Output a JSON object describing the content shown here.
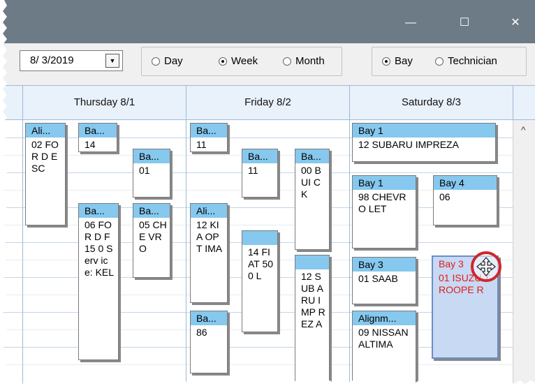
{
  "window": {
    "controls": {
      "minimize": "—",
      "maximize": "☐",
      "close": "✕"
    }
  },
  "toolbar": {
    "date_value": "8/  3/2019",
    "dropdown_icon": "chevron-down-icon",
    "view_options": [
      {
        "label": "Day",
        "selected": false
      },
      {
        "label": "Week",
        "selected": true
      },
      {
        "label": "Month",
        "selected": false
      }
    ],
    "group_options": [
      {
        "label": "Bay",
        "selected": true
      },
      {
        "label": "Technician",
        "selected": false
      }
    ]
  },
  "columns": [
    {
      "label": "Thursday 8/1"
    },
    {
      "label": "Friday 8/2"
    },
    {
      "label": "Saturday 8/3"
    }
  ],
  "appointments": [
    {
      "header": "Ali...",
      "body": "02 FOR D ESC"
    },
    {
      "header": "Ba...",
      "body": "14"
    },
    {
      "header": "Ba...",
      "body": "01"
    },
    {
      "header": "Ba...",
      "body": "06 FOR D F15 0 Serv ice: KEL"
    },
    {
      "header": "Ba...",
      "body": "05 CHE VRO"
    },
    {
      "header": "Ba...",
      "body": "11"
    },
    {
      "header": "Ba...",
      "body": "11"
    },
    {
      "header": "Ba...",
      "body": "00 BUI CK"
    },
    {
      "header": "Ali...",
      "body": "12 KIA OPT IMA"
    },
    {
      "header": "",
      "body": "14 FIAT 500 L"
    },
    {
      "header": "",
      "body": "12 SUB ARU IMP REZ A"
    },
    {
      "header": "Ba...",
      "body": "86"
    },
    {
      "header": "Bay 1",
      "body": "12 SUBARU IMPREZA"
    },
    {
      "header": "Bay 1",
      "body": "98 CHEVRO LET"
    },
    {
      "header": "Bay 4",
      "body": "06"
    },
    {
      "header": "Bay 3",
      "body": "01 SAAB"
    },
    {
      "header": "Bay 3",
      "body": "01 ISUZU TROOPE R"
    },
    {
      "header": "Alignm...",
      "body": "09 NISSAN ALTIMA"
    }
  ],
  "scrollbar": {
    "up_arrow": "^"
  },
  "colors": {
    "titlebar": "#6d7b86",
    "appt_header": "#86c8ee",
    "selected_text": "#e21b1b",
    "selected_bg": "#c7d9f3",
    "cursor_ring": "#d0262c"
  }
}
